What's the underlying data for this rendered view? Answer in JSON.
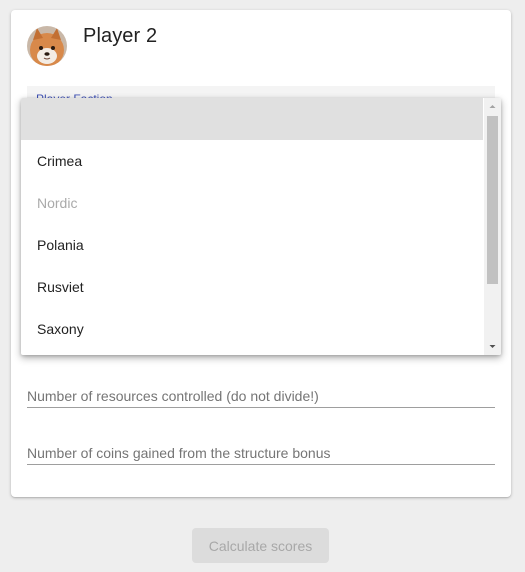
{
  "player": {
    "name": "Player 2",
    "avatar_icon": "shiba-dog-avatar"
  },
  "faction_select": {
    "label": "Player Faction",
    "options": [
      {
        "label": ""
      },
      {
        "label": "Crimea"
      },
      {
        "label": "Nordic"
      },
      {
        "label": "Polania"
      },
      {
        "label": "Rusviet"
      },
      {
        "label": "Saxony"
      }
    ],
    "highlighted_index": 0,
    "disabled_option": "Nordic"
  },
  "fields": {
    "resources_placeholder": "Number of resources controlled (do not divide!)",
    "coins_placeholder": "Number of coins gained from the structure bonus"
  },
  "actions": {
    "calculate_label": "Calculate scores"
  },
  "colors": {
    "background": "#eeeeee",
    "card": "#ffffff",
    "label_accent": "#3f51b5",
    "highlight": "#e0e0e0",
    "disabled_text": "#aaaaaa",
    "button_disabled_bg": "#dcdcdc"
  }
}
